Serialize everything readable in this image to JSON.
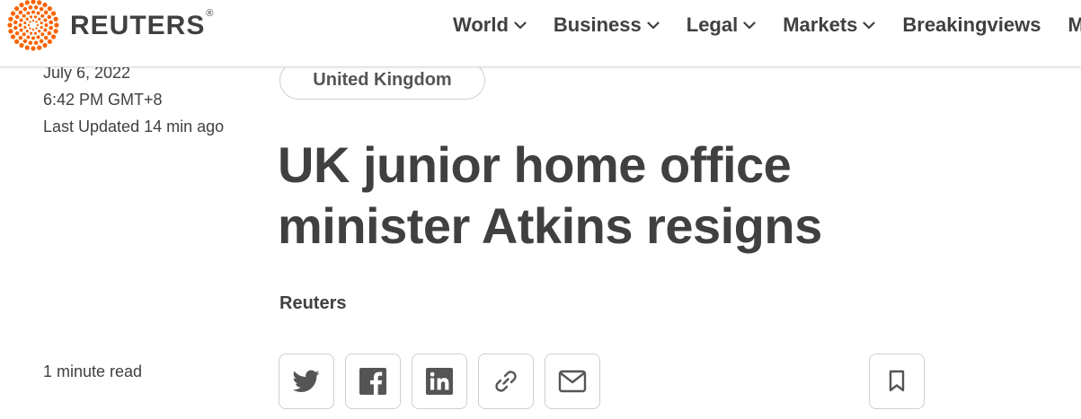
{
  "brand": {
    "name": "REUTERS",
    "registered": "®",
    "logo_icon": "reuters-dot-globe",
    "accent_color": "#fa6400"
  },
  "nav": {
    "items": [
      {
        "label": "World",
        "has_dropdown": true
      },
      {
        "label": "Business",
        "has_dropdown": true
      },
      {
        "label": "Legal",
        "has_dropdown": true
      },
      {
        "label": "Markets",
        "has_dropdown": true
      },
      {
        "label": "Breakingviews",
        "has_dropdown": false
      },
      {
        "label": "Mo",
        "has_dropdown": false
      }
    ]
  },
  "article": {
    "date": "July 6, 2022",
    "time": "6:42 PM GMT+8",
    "updated": "Last Updated 14 min ago",
    "tag": "United Kingdom",
    "headline": "UK junior home office minister Atkins resigns",
    "byline": "Reuters",
    "read_time": "1 minute read"
  },
  "share": {
    "buttons": [
      {
        "icon": "twitter-icon"
      },
      {
        "icon": "facebook-icon"
      },
      {
        "icon": "linkedin-icon"
      },
      {
        "icon": "link-icon"
      },
      {
        "icon": "email-icon"
      }
    ],
    "bookmark_icon": "bookmark-icon"
  },
  "colors": {
    "text": "#404040",
    "border": "#cfcfcf",
    "icon": "#555555"
  }
}
